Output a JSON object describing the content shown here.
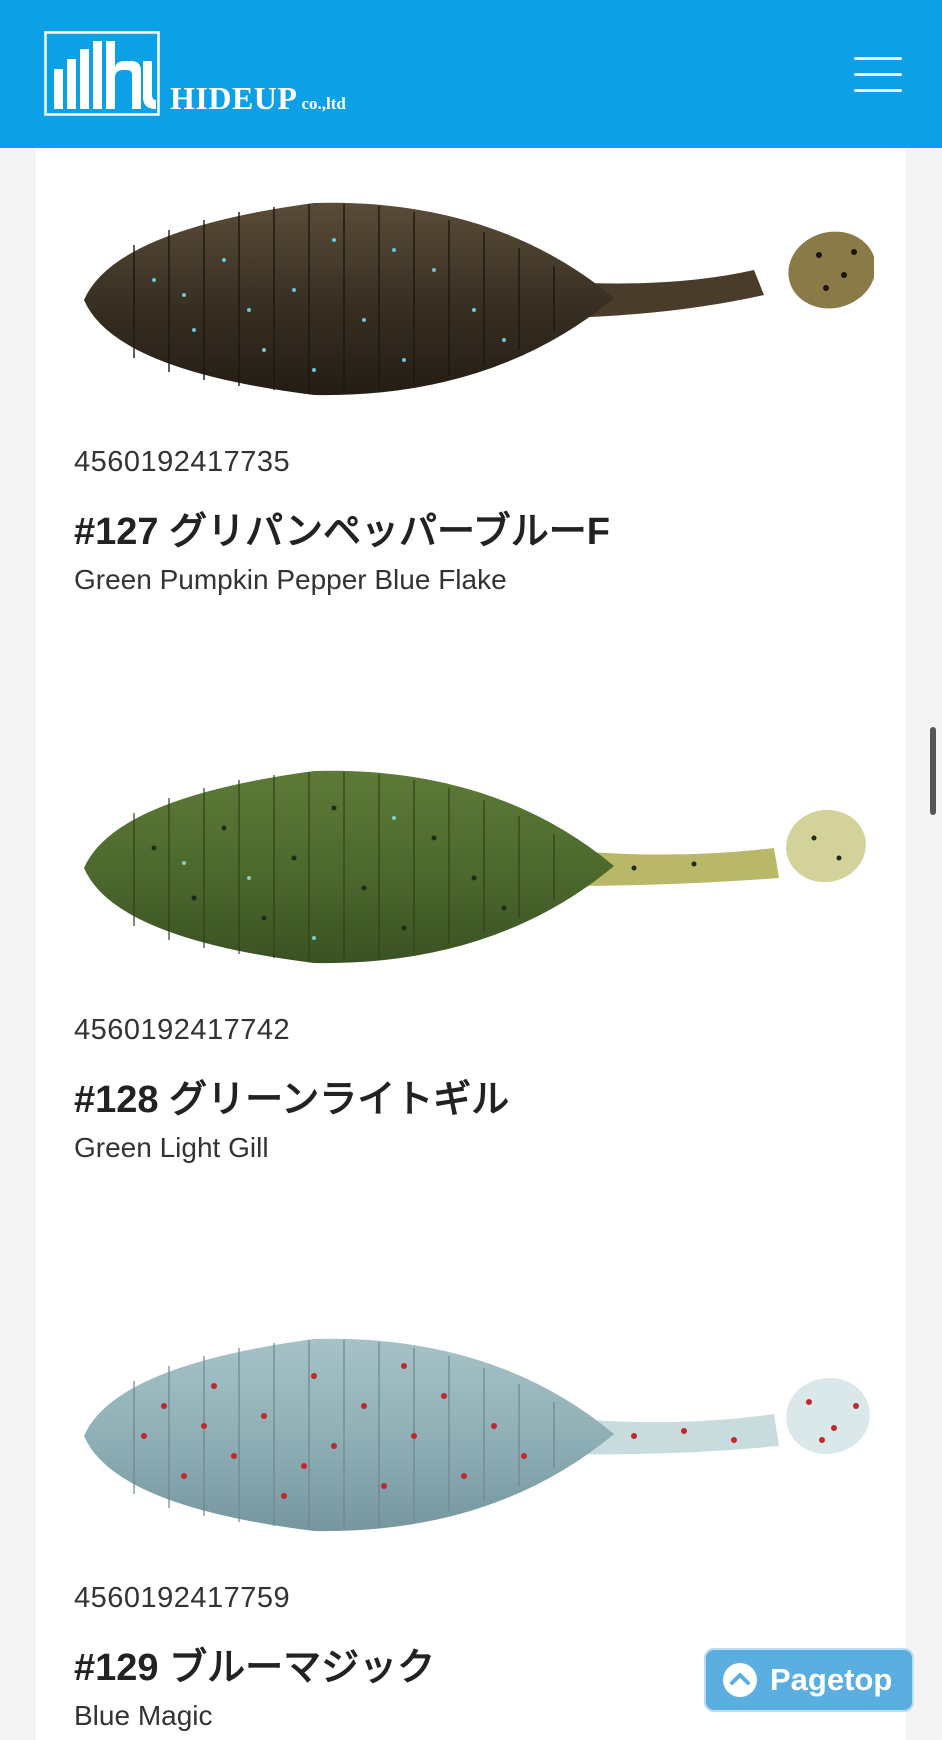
{
  "header": {
    "brand_name": "HIDEUP",
    "brand_suffix": "co.,ltd",
    "logo_text": "hu",
    "colors": {
      "background": "#0ca0e6",
      "text": "#ffffff"
    }
  },
  "products": [
    {
      "code": "4560192417735",
      "name": "#127 グリパンペッパーブルーF",
      "english_name": "Green Pumpkin Pepper Blue Flake",
      "colors": {
        "body": "#3a3024",
        "tail": "#7a6a40",
        "fleck": "#5fb8c8"
      }
    },
    {
      "code": "4560192417742",
      "name": "#128 グリーンライトギル",
      "english_name": "Green Light Gill",
      "colors": {
        "body": "#4d6a2e",
        "tail": "#c4c27a",
        "fleck": "#2a3a20"
      }
    },
    {
      "code": "4560192417759",
      "name": "#129 ブルーマジック",
      "english_name": "Blue Magic",
      "colors": {
        "body": "#8fb0b6",
        "tail": "#cfe0e2",
        "fleck": "#c0282c"
      }
    }
  ],
  "pagetop": {
    "label": "Pagetop",
    "icon": "chevron-up-circle-icon"
  },
  "menu": {
    "icon": "hamburger-menu-icon"
  }
}
